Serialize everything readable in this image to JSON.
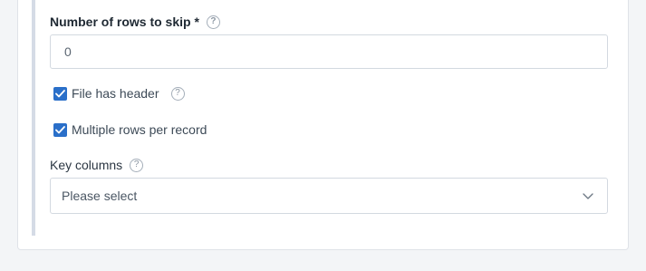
{
  "form": {
    "rows_to_skip": {
      "label": "Number of rows to skip *",
      "help_icon": "?",
      "value": "0"
    },
    "file_has_header": {
      "label": "File has header",
      "checked": true,
      "help_icon": "?"
    },
    "multiple_rows": {
      "label": "Multiple rows per record",
      "checked": true
    },
    "key_columns": {
      "label": "Key columns",
      "help_icon": "?",
      "placeholder": "Please select"
    }
  },
  "colors": {
    "accent": "#2a6fc9",
    "border": "#d3d9e0",
    "panel_bar": "#d5dbe6"
  },
  "icons": {
    "help": "question-circle-icon",
    "check": "checkmark-icon",
    "dropdown": "chevron-down-icon"
  }
}
